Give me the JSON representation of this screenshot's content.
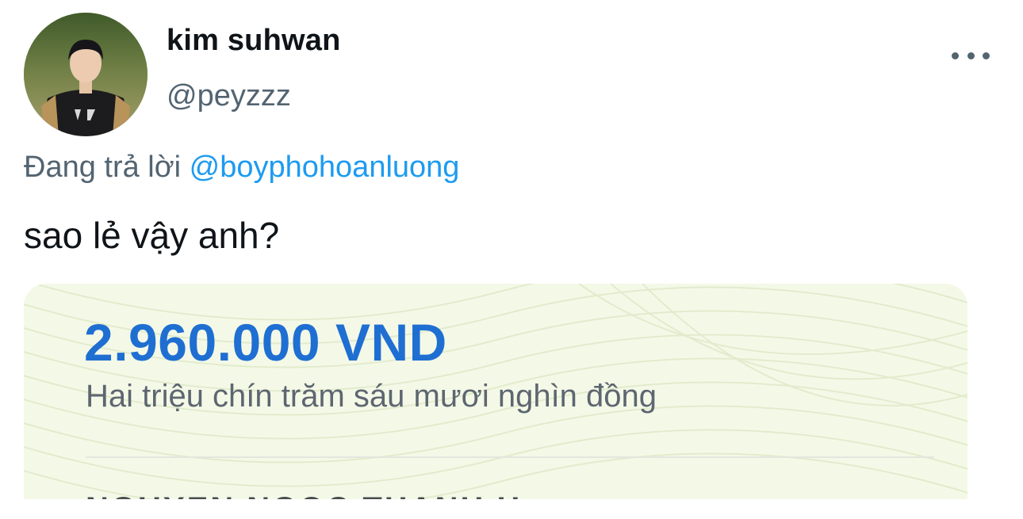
{
  "user": {
    "display_name": "kim suhwan",
    "handle": "@peyzzz",
    "avatar_icon": "avatar-photo"
  },
  "reply": {
    "prefix": "Đang trả lời",
    "mention": "@boyphohoanluong"
  },
  "tweet": {
    "text": "sao lẻ vậy anh?"
  },
  "media": {
    "amount": "2.960.000 VND",
    "amount_words": "Hai triệu chín trăm sáu mươi nghìn đồng",
    "cut_off_text": "NGUYEN NGOC THANH H"
  },
  "colors": {
    "mention": "#1d9bf0",
    "secondary_text": "#536471",
    "primary_text": "#0f1419",
    "amount": "#1f6fd2"
  },
  "icons": {
    "more": "more-horizontal-icon"
  }
}
